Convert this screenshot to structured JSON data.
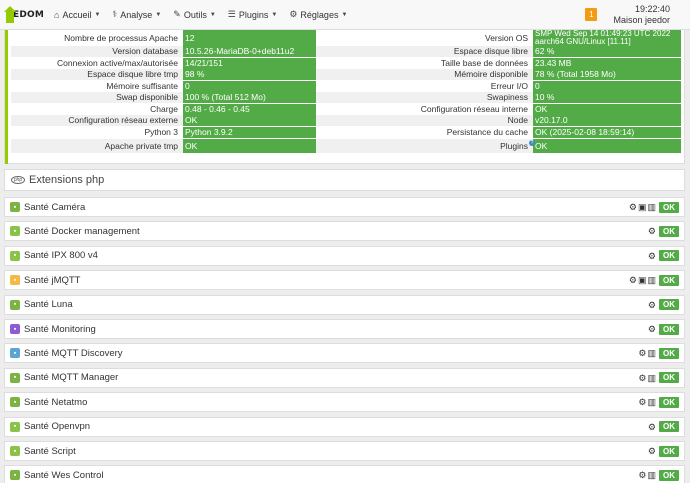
{
  "navbar": {
    "logo_text": "EEDOM",
    "menu": [
      {
        "label": "Accueil",
        "icon": "home-icon",
        "glyph": "⌂"
      },
      {
        "label": "Analyse",
        "icon": "analyse-icon",
        "glyph": "⚕"
      },
      {
        "label": "Outils",
        "icon": "wrench-icon",
        "glyph": "✎"
      },
      {
        "label": "Plugins",
        "icon": "list-icon",
        "glyph": "☰"
      },
      {
        "label": "Réglages",
        "icon": "gear-icon",
        "glyph": "⚙"
      }
    ],
    "notification_count": "1",
    "time": "19:22:40",
    "house_name": "Maison jeedor"
  },
  "system_info": {
    "rows": [
      {
        "left_label": "Nombre de processus Apache",
        "left_value": "12",
        "right_label": "Version OS",
        "right_value": "SMP Wed Sep 14 01:49:23 UTC 2022 aarch64 GNU/Linux [11.11]"
      },
      {
        "left_label": "Version database",
        "left_value": "10.5.26-MariaDB-0+deb11u2",
        "right_label": "Espace disque libre",
        "right_value": "62 %"
      },
      {
        "left_label": "Connexion active/max/autorisée",
        "left_value": "14/21/151",
        "right_label": "Taille base de données",
        "right_value": "23.43 MB"
      },
      {
        "left_label": "Espace disque libre tmp",
        "left_value": "98 %",
        "right_label": "Mémoire disponible",
        "right_value": "78 % (Total 1958 Mo)"
      },
      {
        "left_label": "Mémoire suffisante",
        "left_value": "0",
        "right_label": "Erreur I/O",
        "right_value": "0"
      },
      {
        "left_label": "Swap disponible",
        "left_value": "100 % (Total 512 Mo)",
        "right_label": "Swapiness",
        "right_value": "10 %"
      },
      {
        "left_label": "Charge",
        "left_value": "0.48 - 0.46 - 0.45",
        "right_label": "Configuration réseau interne",
        "right_value": "OK"
      },
      {
        "left_label": "Configuration réseau externe",
        "left_value": "OK",
        "right_label": "Node",
        "right_value": "v20.17.0"
      },
      {
        "left_label": "Python 3",
        "left_value": "Python 3.9.2",
        "right_label": "Persistance du cache",
        "right_value": "OK (2025-02-08 18:59:14)"
      },
      {
        "left_label": "Apache private tmp",
        "left_value": "OK",
        "right_label": "Plugins",
        "right_value": "OK"
      }
    ]
  },
  "extensions": {
    "title": "Extensions php"
  },
  "plugins": [
    {
      "label": "Santé Caméra",
      "color": "#7cb342",
      "actions": [
        "gears-icon",
        "camera-icon",
        "trash-icon"
      ],
      "status": "OK"
    },
    {
      "label": "Santé Docker management",
      "color": "#8bc34a",
      "actions": [
        "gears-icon"
      ],
      "status": "OK"
    },
    {
      "label": "Santé IPX 800 v4",
      "color": "#8bc34a",
      "actions": [
        "gears-icon"
      ],
      "status": "OK"
    },
    {
      "label": "Santé jMQTT",
      "color": "#f5b945",
      "actions": [
        "gears-icon",
        "camera-icon",
        "trash-icon"
      ],
      "status": "OK"
    },
    {
      "label": "Santé Luna",
      "color": "#7cb342",
      "actions": [
        "gears-icon"
      ],
      "status": "OK"
    },
    {
      "label": "Santé Monitoring",
      "color": "#8e5bd6",
      "actions": [
        "gears-icon"
      ],
      "status": "OK"
    },
    {
      "label": "Santé MQTT Discovery",
      "color": "#5aa5d6",
      "actions": [
        "gears-icon",
        "trash-icon"
      ],
      "status": "OK"
    },
    {
      "label": "Santé MQTT Manager",
      "color": "#7cb342",
      "actions": [
        "gears-icon",
        "trash-icon"
      ],
      "status": "OK"
    },
    {
      "label": "Santé Netatmo",
      "color": "#7cb342",
      "actions": [
        "gears-icon",
        "trash-icon"
      ],
      "status": "OK"
    },
    {
      "label": "Santé Openvpn",
      "color": "#8bc34a",
      "actions": [
        "gears-icon"
      ],
      "status": "OK"
    },
    {
      "label": "Santé Script",
      "color": "#8bc34a",
      "actions": [
        "gears-icon"
      ],
      "status": "OK"
    },
    {
      "label": "Santé Wes Control",
      "color": "#7cb342",
      "actions": [
        "gears-icon",
        "trash-icon"
      ],
      "status": "OK"
    }
  ]
}
